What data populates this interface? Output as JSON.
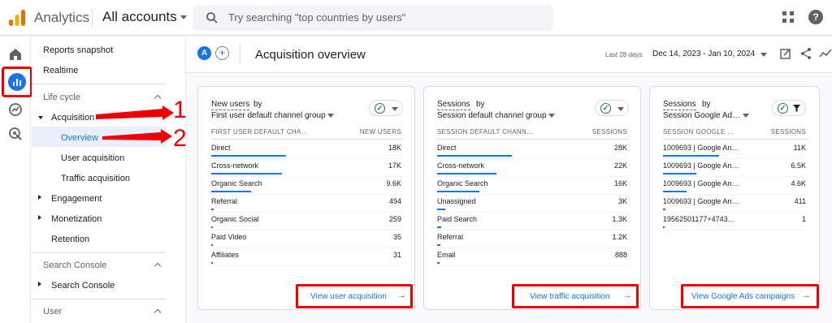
{
  "topbar": {
    "app_name": "Analytics",
    "account_selector": "All accounts",
    "search_placeholder": "Try searching \"top countries by users\"",
    "help_label": "?"
  },
  "sidenav": {
    "reports_snapshot": "Reports snapshot",
    "realtime": "Realtime",
    "section_lifecycle": "Life cycle",
    "acquisition": "Acquisition",
    "overview": "Overview",
    "user_acquisition": "User acquisition",
    "traffic_acquisition": "Traffic acquisition",
    "engagement": "Engagement",
    "monetization": "Monetization",
    "retention": "Retention",
    "section_search_console": "Search Console",
    "search_console": "Search Console",
    "section_user": "User"
  },
  "header": {
    "avatar_letter": "A",
    "add_label": "+",
    "title": "Acquisition overview",
    "range_label": "Last 28 days",
    "range_value": "Dec 14, 2023 - Jan 10, 2024"
  },
  "annotations": {
    "step1": "1",
    "step2": "2"
  },
  "cards": [
    {
      "metric_part1": "New users",
      "metric_part2": " by",
      "dimension": "First user default channel group",
      "col_dim": "FIRST USER DEFAULT CHA…",
      "col_metric": "NEW USERS",
      "rows": [
        {
          "label": "Direct",
          "value": "18K",
          "share": 1.0
        },
        {
          "label": "Cross-network",
          "value": "17K",
          "share": 0.94
        },
        {
          "label": "Organic Search",
          "value": "9.6K",
          "share": 0.53
        },
        {
          "label": "Referral",
          "value": "494",
          "share": 0.03
        },
        {
          "label": "Organic Social",
          "value": "259",
          "share": 0.015
        },
        {
          "label": "Paid Video",
          "value": "35",
          "share": 0.005
        },
        {
          "label": "Affiliates",
          "value": "31",
          "share": 0.005
        }
      ],
      "cta": "View user acquisition"
    },
    {
      "metric_part1": "Sessions",
      "metric_part2": " by",
      "dimension": "Session default channel group",
      "col_dim": "SESSION DEFAULT CHANN…",
      "col_metric": "SESSIONS",
      "rows": [
        {
          "label": "Direct",
          "value": "28K",
          "share": 1.0
        },
        {
          "label": "Cross-network",
          "value": "22K",
          "share": 0.79
        },
        {
          "label": "Organic Search",
          "value": "16K",
          "share": 0.57
        },
        {
          "label": "Unassigned",
          "value": "3K",
          "share": 0.11
        },
        {
          "label": "Paid Search",
          "value": "1.3K",
          "share": 0.05
        },
        {
          "label": "Referral",
          "value": "1.2K",
          "share": 0.04
        },
        {
          "label": "Email",
          "value": "888",
          "share": 0.03
        }
      ],
      "cta": "View traffic acquisition"
    },
    {
      "metric_part1": "Sessions",
      "metric_part2": " by",
      "dimension": "Session Google Ad…",
      "col_dim": "SESSION GOOGLE …",
      "col_metric": "SESSIONS",
      "rows": [
        {
          "label": "1009693 | Google An…",
          "value": "11K",
          "share": 1.0
        },
        {
          "label": "1009693 | Google An…",
          "value": "6.5K",
          "share": 0.59
        },
        {
          "label": "1009693 | Google An…",
          "value": "4.6K",
          "share": 0.42
        },
        {
          "label": "1009693 | Google An…",
          "value": "411",
          "share": 0.04
        },
        {
          "label": "19562501177+4743…",
          "value": "1",
          "share": 0.0
        }
      ],
      "cta": "View Google Ads campaigns"
    }
  ],
  "colors": {
    "accent": "#1a73e8",
    "annotation": "#e00000",
    "success": "#188038"
  }
}
